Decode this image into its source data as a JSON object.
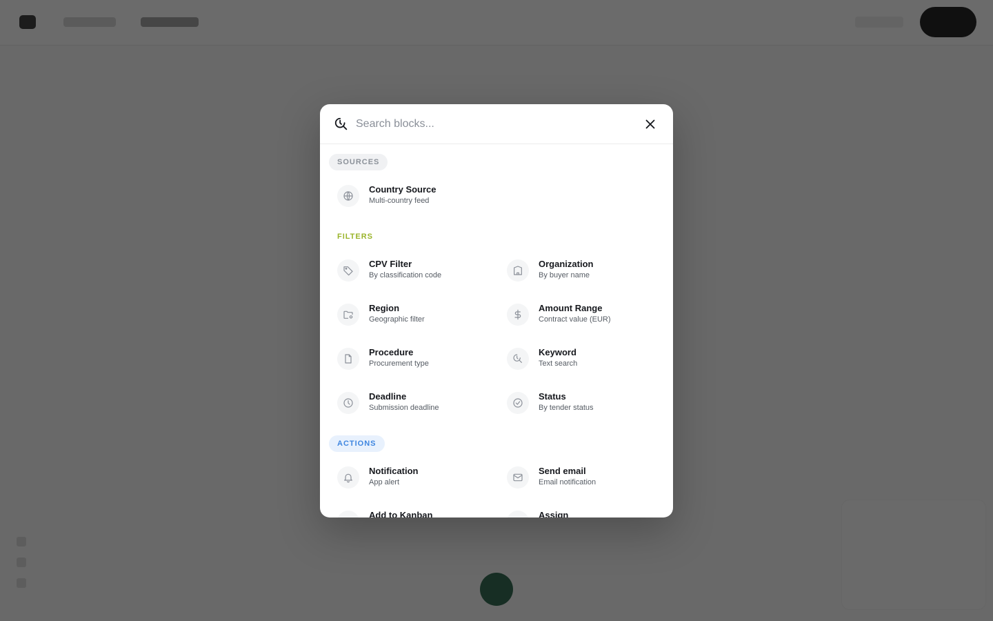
{
  "search": {
    "placeholder": "Search blocks..."
  },
  "sections": {
    "sources": {
      "label": "SOURCES",
      "items": [
        {
          "title": "Country Source",
          "subtitle": "Multi-country feed",
          "icon": "globe-icon"
        }
      ]
    },
    "filters": {
      "label": "FILTERS",
      "items": [
        {
          "title": "CPV Filter",
          "subtitle": "By classification code",
          "icon": "tag-icon"
        },
        {
          "title": "Organization",
          "subtitle": "By buyer name",
          "icon": "building-icon"
        },
        {
          "title": "Region",
          "subtitle": "Geographic filter",
          "icon": "map-pin-icon"
        },
        {
          "title": "Amount Range",
          "subtitle": "Contract value (EUR)",
          "icon": "dollar-icon"
        },
        {
          "title": "Procedure",
          "subtitle": "Procurement type",
          "icon": "document-icon"
        },
        {
          "title": "Keyword",
          "subtitle": "Text search",
          "icon": "keyword-search-icon"
        },
        {
          "title": "Deadline",
          "subtitle": "Submission deadline",
          "icon": "clock-icon"
        },
        {
          "title": "Status",
          "subtitle": "By tender status",
          "icon": "check-circle-icon"
        }
      ]
    },
    "actions": {
      "label": "ACTIONS",
      "items": [
        {
          "title": "Notification",
          "subtitle": "App alert",
          "icon": "bell-icon"
        },
        {
          "title": "Send email",
          "subtitle": "Email notification",
          "icon": "mail-icon"
        },
        {
          "title": "Add to Kanban",
          "subtitle": "",
          "icon": "kanban-icon"
        },
        {
          "title": "Assign",
          "subtitle": "",
          "icon": "assign-icon"
        }
      ]
    }
  },
  "colors": {
    "overlay": "#141414",
    "sources_label": "#8b9199",
    "filters_label": "#9ab42a",
    "actions_label": "#3f86e0",
    "icon_stroke": "#8a8f98"
  }
}
